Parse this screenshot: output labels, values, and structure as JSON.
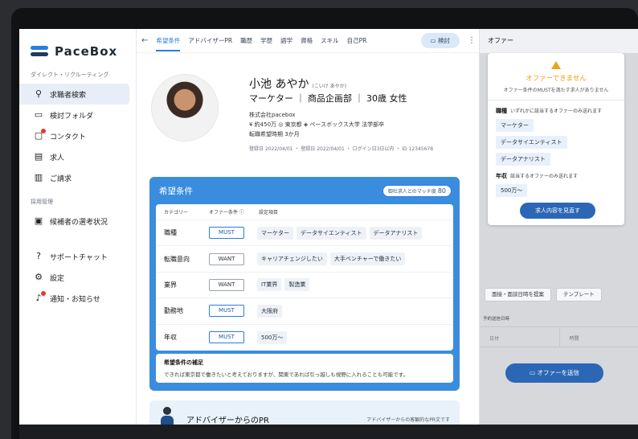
{
  "sidebar": {
    "logo": "PaceBox",
    "section1": "ダイレクト・リクルーティング",
    "items1": [
      {
        "label": "求職者検索",
        "icon": "person-search-icon"
      },
      {
        "label": "検討フォルダ",
        "icon": "folder-icon"
      },
      {
        "label": "コンタクト",
        "icon": "contact-icon"
      },
      {
        "label": "求人",
        "icon": "document-icon"
      },
      {
        "label": "ご請求",
        "icon": "invoice-icon"
      }
    ],
    "section2": "採用管理",
    "items2": [
      {
        "label": "候補者の選考状況",
        "icon": "candidate-icon"
      }
    ],
    "items3": [
      {
        "label": "サポートチャット",
        "icon": "chat-icon"
      },
      {
        "label": "設定",
        "icon": "gear-icon"
      },
      {
        "label": "通知・お知らせ",
        "icon": "bell-icon"
      }
    ]
  },
  "tabs": [
    "希望条件",
    "アドバイザーPR",
    "職歴",
    "学歴",
    "語学",
    "資格",
    "スキル",
    "自己PR"
  ],
  "review_button": "検討",
  "profile": {
    "name": "小池 あやか",
    "kana": "(こいけ あやか)",
    "role": "マーケター ｜ 商品企画部 ｜ 30歳 女性",
    "company": "株式会社pacebox",
    "details": "¥ 約450万  ◎ 東京都  ◈ ペースボックス大学 法学部卒",
    "timing": "転職希望時期 3か月",
    "footer": "登録日 2022/04/01 ・ 登録日 2022/04/01 ・ ログイン日3日以内 ・ ID 12345678"
  },
  "conditions": {
    "title": "希望条件",
    "match_label": "御社求人とのマッチ度",
    "match_value": "80",
    "headers": [
      "カテゴリー",
      "オファー条件 ⓘ",
      "設定項目"
    ],
    "rows": [
      {
        "cat": "職種",
        "level": "MUST",
        "items": [
          "マーケター",
          "データサイエンティスト",
          "データアナリスト"
        ]
      },
      {
        "cat": "転職意向",
        "level": "WANT",
        "items": [
          "キャリアチェンジしたい",
          "大手ベンチャーで働きたい"
        ]
      },
      {
        "cat": "業界",
        "level": "WANT",
        "items": [
          "IT業界",
          "製造業"
        ]
      },
      {
        "cat": "勤務地",
        "level": "MUST",
        "items": [
          "大阪府"
        ]
      },
      {
        "cat": "年収",
        "level": "MUST",
        "items": [
          "500万〜"
        ]
      }
    ],
    "supplement_title": "希望条件の補足",
    "supplement_body": "できれば東京都で働きたいと考えておりますが、関東であれば引っ越しも視野に入れることも可能です。"
  },
  "advisor": {
    "title": "アドバイザーからのPR",
    "sub": "アドバイザーからの客観的なPR文です"
  },
  "offer": {
    "title": "オファー",
    "warn_title": "オファーできません",
    "warn_sub": "オファー条件のMUSTを満たす求人がありません",
    "job_label": "職種",
    "job_note": "いずれかに該当するオファーのみ送れます",
    "job_tags": [
      "マーケター",
      "データサイエンティスト",
      "データアナリスト"
    ],
    "salary_label": "年収",
    "salary_note": "該当するオファーのみ送れます",
    "salary_tag": "500万〜",
    "review_btn": "求人内容を見直す",
    "btn_interview": "面接・面談日時を提案",
    "btn_template": "テンプレート",
    "schedule_label": "予約送信日時",
    "date_ph": "日付",
    "time_ph": "時間",
    "send": "オファーを送信"
  }
}
